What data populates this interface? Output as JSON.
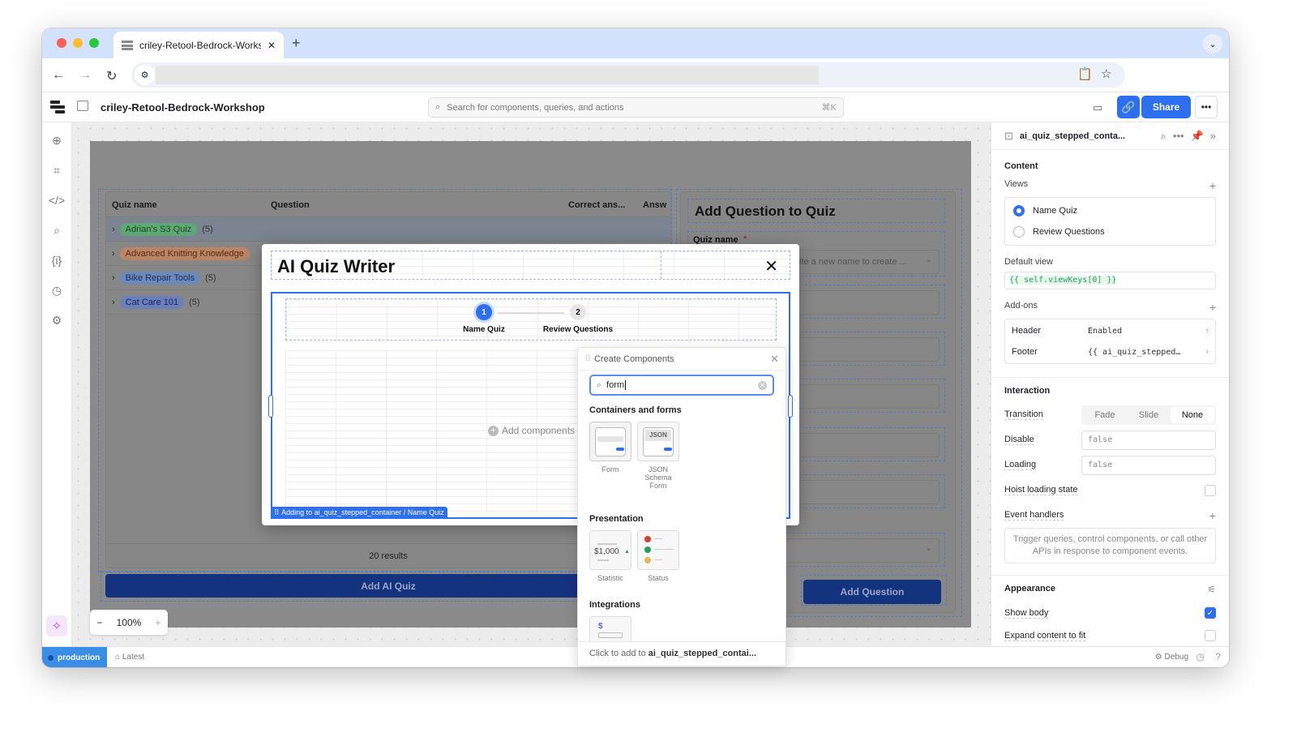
{
  "browser": {
    "tab_title": "criley-Retool-Bedrock-Workshop",
    "new_tab": "+",
    "close_tab": "✕"
  },
  "app": {
    "title": "criley-Retool-Bedrock-Workshop",
    "search_placeholder": "Search for components, queries, and actions",
    "search_shortcut": "⌘K",
    "share_label": "Share"
  },
  "canvas": {
    "table": {
      "columns": [
        "Quiz name",
        "Question",
        "Correct ans...",
        "Answ"
      ],
      "rows": [
        {
          "name": "Adrian's S3 Quiz",
          "count": "(5)",
          "color": "#5ea876"
        },
        {
          "name": "Advanced Knitting Knowledge",
          "count": "",
          "color": "#b98565"
        },
        {
          "name": "Bike Repair Tools",
          "count": "(5)",
          "color": "#6d89b8"
        },
        {
          "name": "Cat Care 101",
          "count": "(5)",
          "color": "#6d7fb8"
        }
      ],
      "results": "20 results"
    },
    "add_ai_quiz": "Add AI Quiz",
    "right_form": {
      "title": "Add Question to Quiz",
      "quiz_name_label": "Quiz name",
      "required_mark": "*",
      "quiz_name_placeholder": "ite a new name to create ...",
      "add_question": "Add Question"
    },
    "zoom": {
      "value": "100%",
      "minus": "−",
      "plus": "+"
    }
  },
  "modal": {
    "title": "AI Quiz Writer",
    "close": "✕",
    "steps": [
      {
        "num": "1",
        "label": "Name Quiz",
        "active": true
      },
      {
        "num": "2",
        "label": "Review Questions",
        "active": false
      }
    ],
    "add_components": "Add components",
    "adding_to": "Adding to ai_quiz_stepped_container / Name Quiz"
  },
  "create_components": {
    "title": "Create Components",
    "search_value": "form",
    "sections": [
      {
        "title": "Containers and forms",
        "items": [
          "Form",
          "JSON Schema Form"
        ]
      },
      {
        "title": "Presentation",
        "items": [
          "Statistic",
          "Status"
        ]
      },
      {
        "title": "Integrations",
        "items": [
          ""
        ]
      }
    ],
    "statistic_preview": "$1,000",
    "json_badge": "JSON",
    "footer_prefix": "Click to add to ",
    "footer_target": "ai_quiz_stepped_contai..."
  },
  "inspector": {
    "component_name": "ai_quiz_stepped_conta...",
    "content_title": "Content",
    "views_label": "Views",
    "views": [
      {
        "label": "Name Quiz",
        "selected": true
      },
      {
        "label": "Review Questions",
        "selected": false
      }
    ],
    "default_view_label": "Default view",
    "default_view_value": "{{ self.viewKeys[0] }}",
    "addons_label": "Add-ons",
    "addons": [
      {
        "key": "Header",
        "value": "Enabled"
      },
      {
        "key": "Footer",
        "value": "{{ ai_quiz_stepped…"
      }
    ],
    "interaction_title": "Interaction",
    "transition_label": "Transition",
    "transition_options": [
      "Fade",
      "Slide",
      "None"
    ],
    "transition_selected": "None",
    "disable_label": "Disable",
    "disable_value": "false",
    "loading_label": "Loading",
    "loading_value": "false",
    "hoist_label": "Hoist loading state",
    "hoist_checked": false,
    "event_handlers_label": "Event handlers",
    "event_handlers_hint": "Trigger queries, control components, or call other APIs in response to component events.",
    "appearance_title": "Appearance",
    "show_body_label": "Show body",
    "show_body_checked": true,
    "expand_label": "Expand content to fit",
    "expand_checked": false
  },
  "footer": {
    "env": "production",
    "branch": "Latest",
    "debug": "Debug"
  }
}
